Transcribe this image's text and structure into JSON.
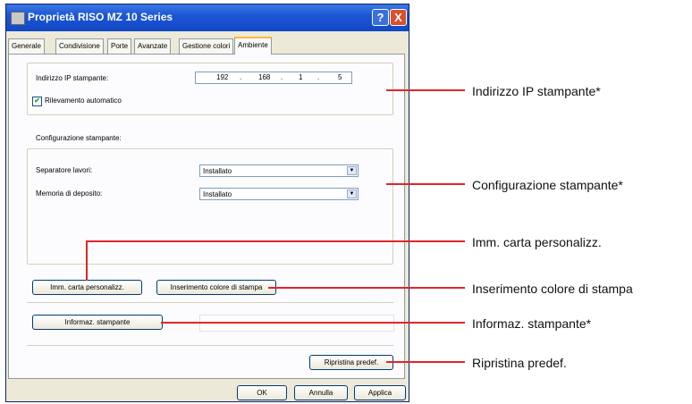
{
  "window": {
    "title": "Proprietà RISO MZ 10 Series",
    "help_label": "?",
    "close_label": "X"
  },
  "tabs": [
    "Generale",
    "Condivisione",
    "Porte",
    "Avanzate",
    "Gestione colori",
    "Ambiente"
  ],
  "ip_section": {
    "label": "Indirizzo IP stampante:",
    "octets": [
      "192",
      "168",
      "1",
      "5"
    ],
    "checkbox_label": "Rilevamento automatico",
    "checkbox_checked": true
  },
  "config_section": {
    "heading": "Configurazione stampante:",
    "separator_label": "Separatore lavori:",
    "separator_value": "Installato",
    "memory_label": "Memoria di deposito:",
    "memory_value": "Installato"
  },
  "buttons": {
    "custom_paper": "Imm. carta personalizz.",
    "print_color": "Inserimento colore di stampa",
    "printer_info": "Informaz. stampante",
    "restore_default": "Ripristina predef.",
    "ok": "OK",
    "cancel": "Annulla",
    "apply": "Applica"
  },
  "callouts": {
    "ip": "Indirizzo IP stampante*",
    "config": "Configurazione stampante*",
    "custom_paper": "Imm. carta personalizz.",
    "print_color": "Inserimento colore di stampa",
    "printer_info": "Informaz. stampante*",
    "restore": "Ripristina predef."
  },
  "colors": {
    "callout": "#e0262a",
    "titlebar": "#1c56d6"
  }
}
